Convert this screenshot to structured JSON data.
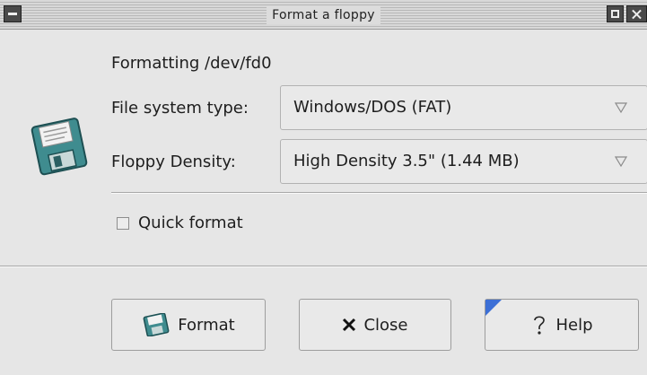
{
  "window": {
    "title": "Format a floppy"
  },
  "status": {
    "formatting_text": "Formatting /dev/fd0"
  },
  "filesystem": {
    "label": "File system type:",
    "value": "Windows/DOS (FAT)"
  },
  "density": {
    "label": "Floppy Density:",
    "value": "High Density 3.5\" (1.44 MB)"
  },
  "quick_format": {
    "label": "Quick format",
    "checked": false
  },
  "buttons": {
    "format": "Format",
    "close": "Close",
    "help": "Help"
  },
  "icons": {
    "dialog": "floppy-disk-icon",
    "format": "floppy-disk-icon",
    "close": "close-x-icon",
    "help": "question-mark-icon",
    "combo_arrow": "triangle-down-icon"
  },
  "colors": {
    "background": "#e6e6e6",
    "floppy": "#3f8c8f",
    "help_accent": "#3c6fd6"
  }
}
